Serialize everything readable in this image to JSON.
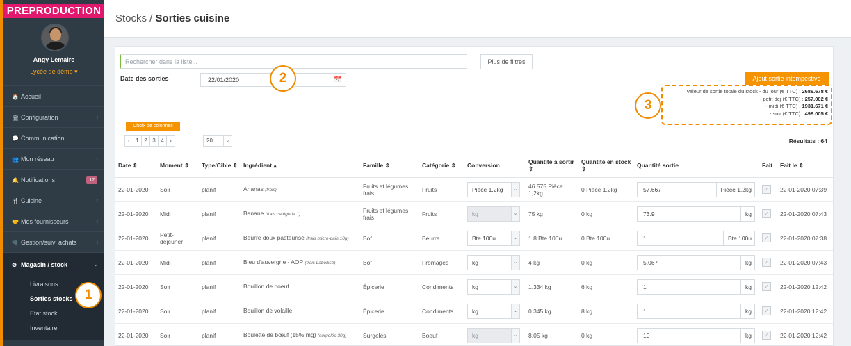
{
  "env_banner": "PREPRODUCTION",
  "user": {
    "name": "Angy Lemaire",
    "school": "Lycée de démo ▾"
  },
  "nav": [
    {
      "icon": "🏠",
      "label": "Accueil"
    },
    {
      "icon": "🏛",
      "label": "Configuration",
      "chevron": "‹"
    },
    {
      "icon": "💬",
      "label": "Communication"
    },
    {
      "icon": "👥",
      "label": "Mon réseau",
      "chevron": "‹"
    },
    {
      "icon": "🔔",
      "label": "Notifications",
      "badge": "17"
    },
    {
      "icon": "🍴",
      "label": "Cuisine",
      "chevron": "‹"
    },
    {
      "icon": "🤝",
      "label": "Mes fournisseurs",
      "chevron": "‹"
    },
    {
      "icon": "🛒",
      "label": "Gestion/suivi achats",
      "chevron": "‹"
    }
  ],
  "nav_active": {
    "icon": "⚙",
    "label": "Magasin / stock",
    "chevron": "⌄"
  },
  "nav_sub": [
    "Livraisons",
    "Sorties stocks",
    "Etat stock",
    "Inventaire"
  ],
  "breadcrumb": {
    "section": "Stocks / ",
    "page": "Sorties cuisine"
  },
  "search": {
    "placeholder": "Rechercher dans la liste..."
  },
  "filters_button": "Plus de filtres",
  "date": {
    "label": "Date des sorties",
    "value": "22/01/2020",
    "icon": "📅"
  },
  "ajout_button": "Ajout sortie intempestive",
  "totals": [
    {
      "label": "Valeur de sortie totale du stock - du jour (€ TTC) : ",
      "value": "2686.678 €"
    },
    {
      "label": "- petit dej (€ TTC) : ",
      "value": "257.002 €"
    },
    {
      "label": "- midi (€ TTC) : ",
      "value": "1931.671 €"
    },
    {
      "label": "- soir (€ TTC) : ",
      "value": "498.005 €"
    }
  ],
  "columns_button": "Choix de colonnes",
  "pager": [
    "‹",
    "1",
    "2",
    "3",
    "4",
    "›"
  ],
  "page_size": "20",
  "results": "Résultats : 64",
  "table": {
    "headers": [
      "Date ⇕",
      "Moment ⇕",
      "Type/Cible ⇕",
      "Ingrédient ▴",
      "Famille ⇕",
      "Catégorie ⇕",
      "Conversion",
      "Quantité à sortir ⇕",
      "Quantité en stock ⇕",
      "Quantité sortie",
      "Fait",
      "Fait le ⇕"
    ],
    "rows": [
      {
        "date": "22-01-2020",
        "moment": "Soir",
        "type": "planif",
        "ingredient": "Ananas",
        "note": "(frais)",
        "famille": "Fruits et légumes frais",
        "categorie": "Fruits",
        "conversion": "Pièce 1,2kg",
        "conv_disabled": false,
        "a_sortir": "46.575 Pièce 1,2kg",
        "en_stock": "0 Pièce 1,2kg",
        "sortie": "57.667",
        "unit": "Pièce 1,2kg",
        "fait_le": "22-01-2020 07:39"
      },
      {
        "date": "22-01-2020",
        "moment": "Midi",
        "type": "planif",
        "ingredient": "Banane",
        "note": "(frais catégorie 1)",
        "famille": "Fruits et légumes frais",
        "categorie": "Fruits",
        "conversion": "kg",
        "conv_disabled": true,
        "a_sortir": "75 kg",
        "en_stock": "0 kg",
        "sortie": "73.9",
        "unit": "kg",
        "fait_le": "22-01-2020 07:43"
      },
      {
        "date": "22-01-2020",
        "moment": "Petit-déjeuner",
        "type": "planif",
        "ingredient": "Beurre doux pasteurisé",
        "note": "(frais micro-pain 10g)",
        "famille": "Bof",
        "categorie": "Beurre",
        "conversion": "Bte 100u",
        "conv_disabled": false,
        "a_sortir": "1.8 Bte 100u",
        "en_stock": "0 Bte 100u",
        "sortie": "1",
        "unit": "Bte 100u",
        "fait_le": "22-01-2020 07:38"
      },
      {
        "date": "22-01-2020",
        "moment": "Midi",
        "type": "planif",
        "ingredient": "Bleu d'auvergne - AOP",
        "note": "(frais Labellisé)",
        "famille": "Bof",
        "categorie": "Fromages",
        "conversion": "kg",
        "conv_disabled": false,
        "a_sortir": "4 kg",
        "en_stock": "0 kg",
        "sortie": "5.067",
        "unit": "kg",
        "fait_le": "22-01-2020 07:43"
      },
      {
        "date": "22-01-2020",
        "moment": "Soir",
        "type": "planif",
        "ingredient": "Bouillon de boeuf",
        "note": "",
        "famille": "Épicerie",
        "categorie": "Condiments",
        "conversion": "kg",
        "conv_disabled": false,
        "a_sortir": "1.334 kg",
        "en_stock": "6 kg",
        "sortie": "1",
        "unit": "kg",
        "fait_le": "22-01-2020 12:42"
      },
      {
        "date": "22-01-2020",
        "moment": "Soir",
        "type": "planif",
        "ingredient": "Bouillon de volaille",
        "note": "",
        "famille": "Épicerie",
        "categorie": "Condiments",
        "conversion": "kg",
        "conv_disabled": false,
        "a_sortir": "0.345 kg",
        "en_stock": "8 kg",
        "sortie": "1",
        "unit": "kg",
        "fait_le": "22-01-2020 12:42"
      },
      {
        "date": "22-01-2020",
        "moment": "Soir",
        "type": "planif",
        "ingredient": "Boulette de bœuf (15% mg)",
        "note": "(surgelés 30g)",
        "famille": "Surgelés",
        "categorie": "Boeuf",
        "conversion": "kg",
        "conv_disabled": true,
        "a_sortir": "8.05 kg",
        "en_stock": "0 kg",
        "sortie": "10",
        "unit": "kg",
        "fait_le": "22-01-2020 12:42"
      }
    ]
  },
  "callouts": [
    "1",
    "2",
    "3"
  ]
}
